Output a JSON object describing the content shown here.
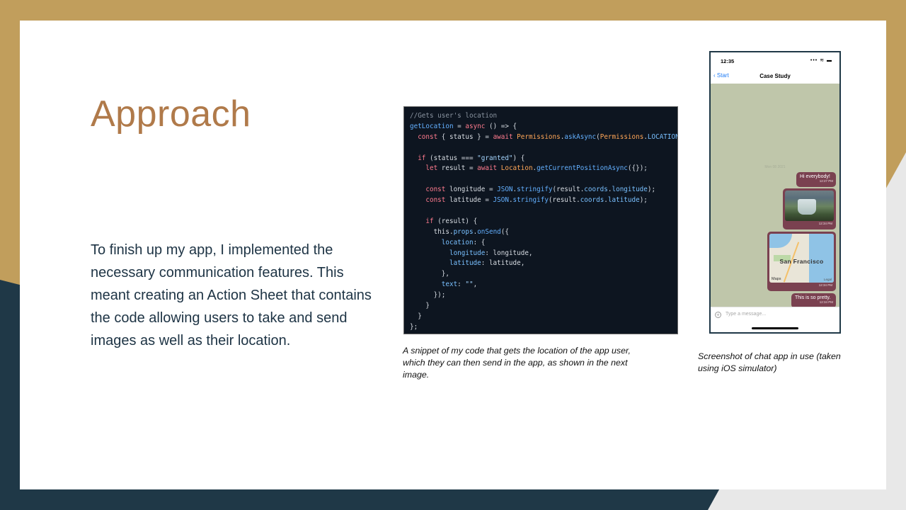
{
  "slide": {
    "title": "Approach",
    "body": "To finish up my app, I implemented the necessary communication features. This meant creating an Action Sheet that contains the code allowing users to take and send images as well as their location.",
    "code_caption": "A snippet of my code that gets the location of the app user, which they can then send in the app, as shown in the next image.",
    "screenshot_caption": "Screenshot of chat app in use (taken using iOS simulator)"
  },
  "code": {
    "l1": "//Gets user's location",
    "l2_fn": "getLocation",
    "l2_op": " = ",
    "l2_kw": "async",
    "l2_rest": " () => {",
    "l3_kw": "  const",
    "l3_mid": " { status } = ",
    "l3_kw2": "await",
    "l3_cls": " Permissions",
    "l3_dot": ".",
    "l3_fn": "askAsync",
    "l3_open": "(",
    "l3_cls2": "Permissions",
    "l3_dot2": ".",
    "l3_prop": "LOCATION",
    "l3_end": ");",
    "l4": "",
    "l5_kw": "  if",
    "l5_mid": " (status === ",
    "l5_str": "\"granted\"",
    "l5_end": ") {",
    "l6_kw": "    let",
    "l6_mid": " result = ",
    "l6_kw2": "await",
    "l6_cls": " Location",
    "l6_dot": ".",
    "l6_fn": "getCurrentPositionAsync",
    "l6_end": "({});",
    "l7": "",
    "l8_kw": "    const",
    "l8_mid": " longitude = ",
    "l8_cls": "JSON",
    "l8_dot": ".",
    "l8_fn": "stringify",
    "l8_open": "(result.",
    "l8_prop": "coords",
    "l8_dot2": ".",
    "l8_prop2": "longitude",
    "l8_end": ");",
    "l9_kw": "    const",
    "l9_mid": " latitude = ",
    "l9_cls": "JSON",
    "l9_dot": ".",
    "l9_fn": "stringify",
    "l9_open": "(result.",
    "l9_prop": "coords",
    "l9_dot2": ".",
    "l9_prop2": "latitude",
    "l9_end": ");",
    "l10": "",
    "l11_kw": "    if",
    "l11_end": " (result) {",
    "l12_a": "      this.",
    "l12_prop": "props",
    "l12_dot": ".",
    "l12_fn": "onSend",
    "l12_end": "({",
    "l13_prop": "        location",
    "l13_end": ": {",
    "l14_prop": "          longitude",
    "l14_end": ": longitude,",
    "l15_prop": "          latitude",
    "l15_end": ": latitude,",
    "l16": "        },",
    "l17_prop": "        text",
    "l17_mid": ": ",
    "l17_str": "\"\"",
    "l17_end": ",",
    "l18": "      });",
    "l19": "    }",
    "l20": "  }",
    "l21": "};"
  },
  "phone": {
    "time": "12:35",
    "status_icons": "••• ≋ ▬",
    "back_label": "‹ Start",
    "nav_title": "Case Study",
    "date_separator": "Mon 08 2021",
    "messages": [
      {
        "text": "Hi everybody!",
        "time": "12:27 PM"
      },
      {
        "image": "waterfall-photo",
        "time": "12:34 PM"
      },
      {
        "map_city": "San Francisco",
        "map_logo": "Maps",
        "map_legal": "Legal",
        "time": "12:34 PM"
      },
      {
        "text": "This is so pretty.",
        "time": "12:34 PM"
      }
    ],
    "input_placeholder": "Type a message...",
    "add_icon": "+"
  },
  "colors": {
    "title": "#b07a4a",
    "body": "#1d3344",
    "bubble": "#7a4150",
    "chat_bg": "#bfc6aa",
    "frame_gold": "#c19e5c",
    "frame_navy": "#1f3847"
  }
}
